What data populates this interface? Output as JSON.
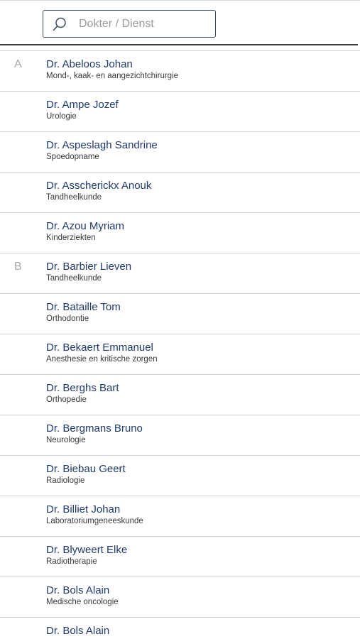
{
  "search": {
    "placeholder": "Dokter / Dienst",
    "value": ""
  },
  "doctors": [
    {
      "letter": "A",
      "name": "Dr. Abeloos Johan",
      "specialty": "Mond-, kaak- en aangezichtchirurgie"
    },
    {
      "letter": "",
      "name": "Dr. Ampe Jozef",
      "specialty": "Urologie"
    },
    {
      "letter": "",
      "name": "Dr. Aspeslagh Sandrine",
      "specialty": "Spoedopname"
    },
    {
      "letter": "",
      "name": "Dr. Asscherickx Anouk",
      "specialty": "Tandheelkunde"
    },
    {
      "letter": "",
      "name": "Dr. Azou Myriam",
      "specialty": "Kinderziekten"
    },
    {
      "letter": "B",
      "name": "Dr. Barbier Lieven",
      "specialty": "Tandheelkunde"
    },
    {
      "letter": "",
      "name": "Dr. Bataille Tom",
      "specialty": "Orthodontie"
    },
    {
      "letter": "",
      "name": "Dr. Bekaert Emmanuel",
      "specialty": "Anesthesie en kritische zorgen"
    },
    {
      "letter": "",
      "name": "Dr. Berghs Bart",
      "specialty": "Orthopedie"
    },
    {
      "letter": "",
      "name": "Dr. Bergmans Bruno",
      "specialty": "Neurologie"
    },
    {
      "letter": "",
      "name": "Dr. Biebau Geert",
      "specialty": "Radiologie"
    },
    {
      "letter": "",
      "name": "Dr. Billiet Johan",
      "specialty": "Laboratoriumgeneeskunde"
    },
    {
      "letter": "",
      "name": "Dr. Blyweert Elke",
      "specialty": "Radiotherapie"
    },
    {
      "letter": "",
      "name": "Dr. Bols Alain",
      "specialty": "Medische oncologie"
    },
    {
      "letter": "",
      "name": "Dr. Bols Alain",
      "specialty": ""
    }
  ]
}
